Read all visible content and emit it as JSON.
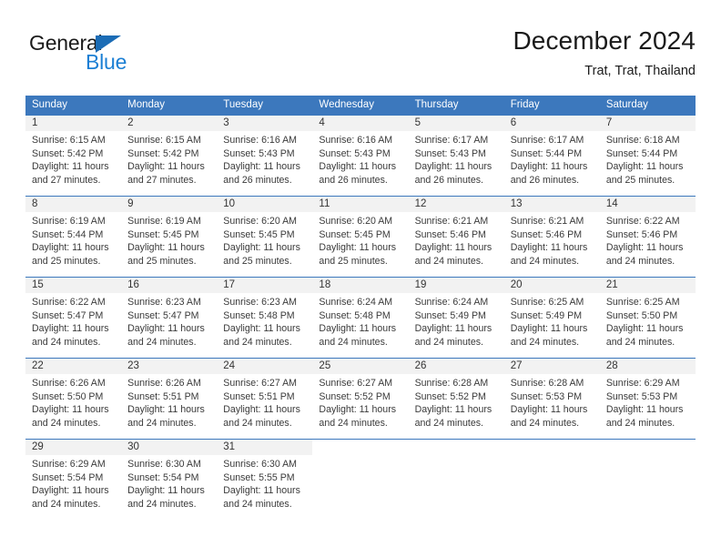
{
  "brand": {
    "name_top": "General",
    "name_bottom": "Blue",
    "triangle_icon": "triangle-icon",
    "color_dark": "#1a1a1a",
    "color_blue": "#1b7fd4"
  },
  "header": {
    "title": "December 2024",
    "location": "Trat, Trat, Thailand"
  },
  "colors": {
    "header_blue": "#3c78bd",
    "daynum_gray": "#f2f2f2",
    "text": "#3a3a3a"
  },
  "calendar": {
    "weekdays": [
      "Sunday",
      "Monday",
      "Tuesday",
      "Wednesday",
      "Thursday",
      "Friday",
      "Saturday"
    ],
    "weeks": [
      [
        {
          "day": "1",
          "sunrise": "Sunrise: 6:15 AM",
          "sunset": "Sunset: 5:42 PM",
          "daylight1": "Daylight: 11 hours",
          "daylight2": "and 27 minutes."
        },
        {
          "day": "2",
          "sunrise": "Sunrise: 6:15 AM",
          "sunset": "Sunset: 5:42 PM",
          "daylight1": "Daylight: 11 hours",
          "daylight2": "and 27 minutes."
        },
        {
          "day": "3",
          "sunrise": "Sunrise: 6:16 AM",
          "sunset": "Sunset: 5:43 PM",
          "daylight1": "Daylight: 11 hours",
          "daylight2": "and 26 minutes."
        },
        {
          "day": "4",
          "sunrise": "Sunrise: 6:16 AM",
          "sunset": "Sunset: 5:43 PM",
          "daylight1": "Daylight: 11 hours",
          "daylight2": "and 26 minutes."
        },
        {
          "day": "5",
          "sunrise": "Sunrise: 6:17 AM",
          "sunset": "Sunset: 5:43 PM",
          "daylight1": "Daylight: 11 hours",
          "daylight2": "and 26 minutes."
        },
        {
          "day": "6",
          "sunrise": "Sunrise: 6:17 AM",
          "sunset": "Sunset: 5:44 PM",
          "daylight1": "Daylight: 11 hours",
          "daylight2": "and 26 minutes."
        },
        {
          "day": "7",
          "sunrise": "Sunrise: 6:18 AM",
          "sunset": "Sunset: 5:44 PM",
          "daylight1": "Daylight: 11 hours",
          "daylight2": "and 25 minutes."
        }
      ],
      [
        {
          "day": "8",
          "sunrise": "Sunrise: 6:19 AM",
          "sunset": "Sunset: 5:44 PM",
          "daylight1": "Daylight: 11 hours",
          "daylight2": "and 25 minutes."
        },
        {
          "day": "9",
          "sunrise": "Sunrise: 6:19 AM",
          "sunset": "Sunset: 5:45 PM",
          "daylight1": "Daylight: 11 hours",
          "daylight2": "and 25 minutes."
        },
        {
          "day": "10",
          "sunrise": "Sunrise: 6:20 AM",
          "sunset": "Sunset: 5:45 PM",
          "daylight1": "Daylight: 11 hours",
          "daylight2": "and 25 minutes."
        },
        {
          "day": "11",
          "sunrise": "Sunrise: 6:20 AM",
          "sunset": "Sunset: 5:45 PM",
          "daylight1": "Daylight: 11 hours",
          "daylight2": "and 25 minutes."
        },
        {
          "day": "12",
          "sunrise": "Sunrise: 6:21 AM",
          "sunset": "Sunset: 5:46 PM",
          "daylight1": "Daylight: 11 hours",
          "daylight2": "and 24 minutes."
        },
        {
          "day": "13",
          "sunrise": "Sunrise: 6:21 AM",
          "sunset": "Sunset: 5:46 PM",
          "daylight1": "Daylight: 11 hours",
          "daylight2": "and 24 minutes."
        },
        {
          "day": "14",
          "sunrise": "Sunrise: 6:22 AM",
          "sunset": "Sunset: 5:46 PM",
          "daylight1": "Daylight: 11 hours",
          "daylight2": "and 24 minutes."
        }
      ],
      [
        {
          "day": "15",
          "sunrise": "Sunrise: 6:22 AM",
          "sunset": "Sunset: 5:47 PM",
          "daylight1": "Daylight: 11 hours",
          "daylight2": "and 24 minutes."
        },
        {
          "day": "16",
          "sunrise": "Sunrise: 6:23 AM",
          "sunset": "Sunset: 5:47 PM",
          "daylight1": "Daylight: 11 hours",
          "daylight2": "and 24 minutes."
        },
        {
          "day": "17",
          "sunrise": "Sunrise: 6:23 AM",
          "sunset": "Sunset: 5:48 PM",
          "daylight1": "Daylight: 11 hours",
          "daylight2": "and 24 minutes."
        },
        {
          "day": "18",
          "sunrise": "Sunrise: 6:24 AM",
          "sunset": "Sunset: 5:48 PM",
          "daylight1": "Daylight: 11 hours",
          "daylight2": "and 24 minutes."
        },
        {
          "day": "19",
          "sunrise": "Sunrise: 6:24 AM",
          "sunset": "Sunset: 5:49 PM",
          "daylight1": "Daylight: 11 hours",
          "daylight2": "and 24 minutes."
        },
        {
          "day": "20",
          "sunrise": "Sunrise: 6:25 AM",
          "sunset": "Sunset: 5:49 PM",
          "daylight1": "Daylight: 11 hours",
          "daylight2": "and 24 minutes."
        },
        {
          "day": "21",
          "sunrise": "Sunrise: 6:25 AM",
          "sunset": "Sunset: 5:50 PM",
          "daylight1": "Daylight: 11 hours",
          "daylight2": "and 24 minutes."
        }
      ],
      [
        {
          "day": "22",
          "sunrise": "Sunrise: 6:26 AM",
          "sunset": "Sunset: 5:50 PM",
          "daylight1": "Daylight: 11 hours",
          "daylight2": "and 24 minutes."
        },
        {
          "day": "23",
          "sunrise": "Sunrise: 6:26 AM",
          "sunset": "Sunset: 5:51 PM",
          "daylight1": "Daylight: 11 hours",
          "daylight2": "and 24 minutes."
        },
        {
          "day": "24",
          "sunrise": "Sunrise: 6:27 AM",
          "sunset": "Sunset: 5:51 PM",
          "daylight1": "Daylight: 11 hours",
          "daylight2": "and 24 minutes."
        },
        {
          "day": "25",
          "sunrise": "Sunrise: 6:27 AM",
          "sunset": "Sunset: 5:52 PM",
          "daylight1": "Daylight: 11 hours",
          "daylight2": "and 24 minutes."
        },
        {
          "day": "26",
          "sunrise": "Sunrise: 6:28 AM",
          "sunset": "Sunset: 5:52 PM",
          "daylight1": "Daylight: 11 hours",
          "daylight2": "and 24 minutes."
        },
        {
          "day": "27",
          "sunrise": "Sunrise: 6:28 AM",
          "sunset": "Sunset: 5:53 PM",
          "daylight1": "Daylight: 11 hours",
          "daylight2": "and 24 minutes."
        },
        {
          "day": "28",
          "sunrise": "Sunrise: 6:29 AM",
          "sunset": "Sunset: 5:53 PM",
          "daylight1": "Daylight: 11 hours",
          "daylight2": "and 24 minutes."
        }
      ],
      [
        {
          "day": "29",
          "sunrise": "Sunrise: 6:29 AM",
          "sunset": "Sunset: 5:54 PM",
          "daylight1": "Daylight: 11 hours",
          "daylight2": "and 24 minutes."
        },
        {
          "day": "30",
          "sunrise": "Sunrise: 6:30 AM",
          "sunset": "Sunset: 5:54 PM",
          "daylight1": "Daylight: 11 hours",
          "daylight2": "and 24 minutes."
        },
        {
          "day": "31",
          "sunrise": "Sunrise: 6:30 AM",
          "sunset": "Sunset: 5:55 PM",
          "daylight1": "Daylight: 11 hours",
          "daylight2": "and 24 minutes."
        },
        {
          "day": "",
          "sunrise": "",
          "sunset": "",
          "daylight1": "",
          "daylight2": ""
        },
        {
          "day": "",
          "sunrise": "",
          "sunset": "",
          "daylight1": "",
          "daylight2": ""
        },
        {
          "day": "",
          "sunrise": "",
          "sunset": "",
          "daylight1": "",
          "daylight2": ""
        },
        {
          "day": "",
          "sunrise": "",
          "sunset": "",
          "daylight1": "",
          "daylight2": ""
        }
      ]
    ]
  }
}
